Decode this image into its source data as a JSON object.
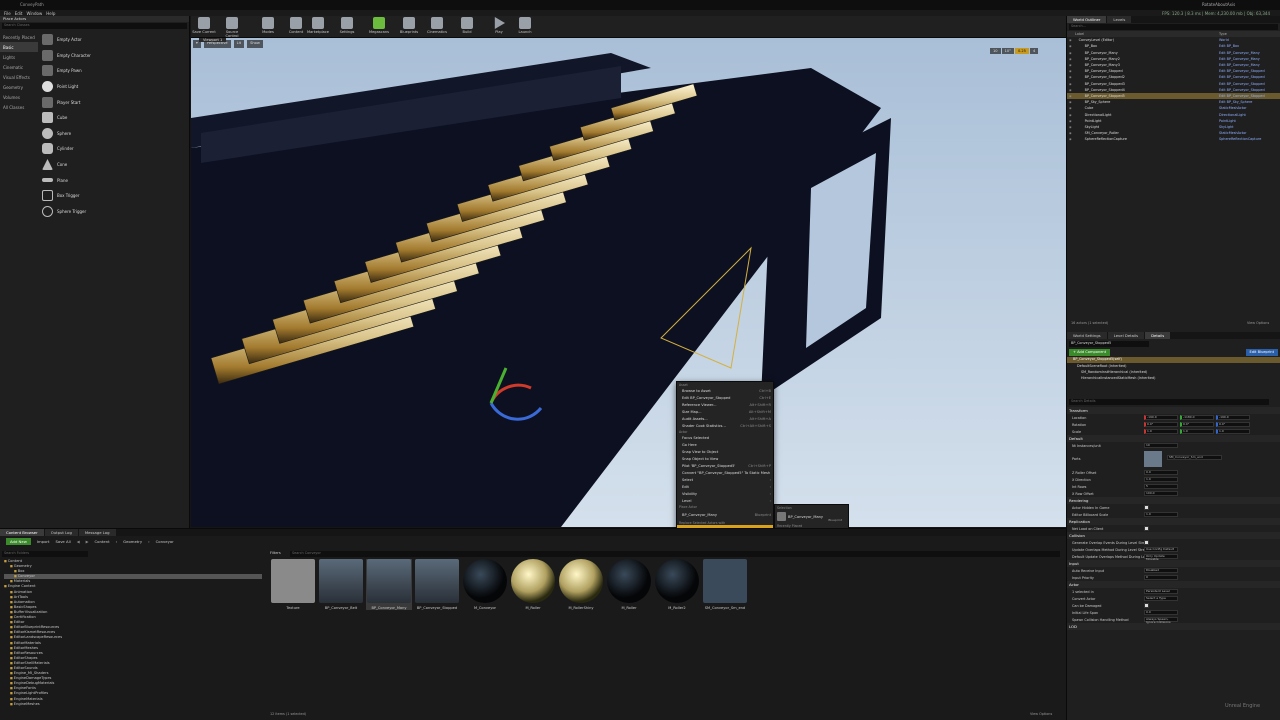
{
  "window": {
    "title": "ConveyPath",
    "right_title": "RotateAboutAxis",
    "stats": "FPS: 120.3  | 8.3 ms | Mem: 4,230.00 mb | Obj: 63,344"
  },
  "menu": [
    "File",
    "Edit",
    "Window",
    "Help"
  ],
  "modes": {
    "tab": "Place Actors",
    "search_placeholder": "Search Classes",
    "categories": [
      "Recently Placed",
      "Basic",
      "Lights",
      "Cinematic",
      "Visual Effects",
      "Geometry",
      "Volumes",
      "All Classes"
    ],
    "items": [
      "Empty Actor",
      "Empty Character",
      "Empty Pawn",
      "Point Light",
      "Player Start",
      "Cube",
      "Sphere",
      "Cylinder",
      "Cone",
      "Plane",
      "Box Trigger",
      "Sphere Trigger"
    ]
  },
  "toolbar": [
    {
      "label": "Save Current"
    },
    {
      "label": "Source Control"
    },
    {
      "label": "Modes"
    },
    {
      "label": "Content"
    },
    {
      "label": "Marketplace"
    },
    {
      "label": "Settings"
    },
    {
      "label": "Megascans"
    },
    {
      "label": "Blueprints"
    },
    {
      "label": "Cinematics"
    },
    {
      "label": "Build"
    },
    {
      "label": "Play"
    },
    {
      "label": "Launch"
    }
  ],
  "viewport": {
    "tab": "Viewport 1",
    "perspective": "Perspective",
    "lit": "Lit",
    "show": "Show",
    "grid": "10",
    "angle": "10°",
    "scale": "0.25",
    "cam": "4"
  },
  "context_menu": {
    "asset_header": "Asset",
    "actor_header": "Actor",
    "place_header": "Place Actor",
    "replace_header": "Replace Selected Actors with",
    "preview_header": "Preview",
    "event_header": "Level Blueprint Events",
    "asset_items": [
      {
        "label": "Browse to Asset",
        "sc": "Ctrl+B"
      },
      {
        "label": "Edit BP_Conveyor_Stopped",
        "sc": "Ctrl+E"
      },
      {
        "label": "Reference Viewer...",
        "sc": "Alt+Shift+R"
      },
      {
        "label": "Size Map...",
        "sc": "Alt+Shift+M"
      },
      {
        "label": "Audit Assets...",
        "sc": "Alt+Shift+A"
      },
      {
        "label": "Shader Cook Statistics...",
        "sc": "Ctrl+Alt+Shift+S"
      }
    ],
    "actor_items": [
      {
        "label": "Focus Selected",
        "sc": ""
      },
      {
        "label": "Go Here",
        "sc": ""
      },
      {
        "label": "Snap View to Object",
        "sc": ""
      },
      {
        "label": "Snap Object to View",
        "sc": ""
      },
      {
        "label": "Pilot 'BP_Conveyor_Stopped5'",
        "sc": "Ctrl+Shift+P"
      },
      {
        "label": "Convert \"BP_Conveyor_Stopped5\" To Static Mesh",
        "sc": ""
      }
    ],
    "mid_items": [
      "Select",
      "Edit",
      "Visibility",
      "Level"
    ],
    "place_item": "BP_Conveyor_Many",
    "place_type": "Blueprint",
    "replace_item": "BP_Conveyor_Many",
    "replace_type": "Blueprint",
    "lower_items": [
      "Merge Actors",
      "Attach To",
      "Transform",
      "Pivot"
    ],
    "preview_item": "Play From Here",
    "event_item": "Add Event"
  },
  "submenu": {
    "headers": [
      "Selection",
      "Recently Placed",
      "Lights",
      "Primitives",
      "Custom Actors"
    ],
    "selection": [
      {
        "label": "BP_Conveyor_Many",
        "type": "Blueprint"
      }
    ],
    "recent": [
      {
        "label": "BP_Conveyor_Many",
        "type": "Blueprint"
      },
      {
        "label": "BP_Conveyor_Belt",
        "type": "Blueprint"
      },
      {
        "label": "BP_Box",
        "type": "Blueprint"
      }
    ],
    "lights": [
      "Directional Light",
      "Spot Light",
      "Point Light",
      "Rect Light"
    ],
    "primitives": [
      "Camera Actor",
      "Player Start",
      "Blocking Volume",
      "Trigger"
    ],
    "custom": [
      "Runtime Virtual Texture Volume"
    ]
  },
  "outliner": {
    "tabs": [
      "World Outliner",
      "Levels"
    ],
    "col_label": "Label",
    "col_type": "Type",
    "search_placeholder": "Search...",
    "rows": [
      {
        "label": "ConveyLevel (Editor)",
        "type": "World"
      },
      {
        "label": "BP_Box",
        "type": "Edit BP_Box"
      },
      {
        "label": "BP_Conveyor_Many",
        "type": "Edit BP_Conveyor_Many"
      },
      {
        "label": "BP_Conveyor_Many2",
        "type": "Edit BP_Conveyor_Many"
      },
      {
        "label": "BP_Conveyor_Many3",
        "type": "Edit BP_Conveyor_Many"
      },
      {
        "label": "BP_Conveyor_Stopped",
        "type": "Edit BP_Conveyor_Stopped"
      },
      {
        "label": "BP_Conveyor_Stopped2",
        "type": "Edit BP_Conveyor_Stopped"
      },
      {
        "label": "BP_Conveyor_Stopped3",
        "type": "Edit BP_Conveyor_Stopped"
      },
      {
        "label": "BP_Conveyor_Stopped4",
        "type": "Edit BP_Conveyor_Stopped"
      },
      {
        "label": "BP_Conveyor_Stopped5",
        "type": "Edit BP_Conveyor_Stopped"
      },
      {
        "label": "BP_Sky_Sphere",
        "type": "Edit BP_Sky_Sphere"
      },
      {
        "label": "Cube",
        "type": "StaticMeshActor"
      },
      {
        "label": "DirectionalLight",
        "type": "DirectionalLight"
      },
      {
        "label": "PointLight",
        "type": "PointLight"
      },
      {
        "label": "SkyLight",
        "type": "SkyLight"
      },
      {
        "label": "SM_Conveyor_Roller",
        "type": "StaticMeshActor"
      },
      {
        "label": "SphereReflectionCapture",
        "type": "SphereReflectionCapture"
      }
    ],
    "footer": "16 actors (1 selected)",
    "view_options": "View Options"
  },
  "details": {
    "tabs": [
      "World Settings",
      "Level Details",
      "Details"
    ],
    "name": "BP_Conveyor_Stopped5",
    "add_component": "+ Add Component",
    "edit_bp": "Edit Blueprint",
    "self": "BP_Conveyor_Stopped5(self)",
    "comps": [
      "DefaultSceneRoot (Inherited)",
      "SM_RandomInstHierarchical (Inherited)",
      "HierarchicalInstancedStaticMesh (Inherited)"
    ],
    "search_placeholder": "Search Details",
    "transform": {
      "header": "Transform",
      "location": {
        "label": "Location",
        "x": "-190.0",
        "y": "-1180.0",
        "z": "-190.0"
      },
      "rotation": {
        "label": "Rotation",
        "x": "0.0°",
        "y": "0.0°",
        "z": "0.0°"
      },
      "scale": {
        "label": "Scale",
        "x": "1.0",
        "y": "1.0",
        "z": "1.0"
      }
    },
    "default": {
      "header": "Default",
      "rows": [
        {
          "label": "Nt Instances/unit",
          "val": "10"
        },
        {
          "label": "Parts",
          "val": "SM_Conveyor_Sm_end"
        },
        {
          "label": "Z Roller Offset",
          "val": "0.0"
        },
        {
          "label": "X Direction",
          "val": "1.0"
        },
        {
          "label": "Int Rows",
          "val": "5"
        },
        {
          "label": "X Row Offset",
          "val": "100.0"
        }
      ]
    },
    "rendering": {
      "header": "Rendering",
      "rows": [
        {
          "label": "Actor Hidden In Game",
          "val": ""
        },
        {
          "label": "Editor Billboard Scale",
          "val": "1.0"
        }
      ]
    },
    "replication": {
      "header": "Replication",
      "rows": [
        {
          "label": "Net Load on Client",
          "val": ""
        }
      ]
    },
    "collision": {
      "header": "Collision",
      "rows": [
        {
          "label": "Generate Overlap Events During Level Stre",
          "val": ""
        },
        {
          "label": "Update Overlaps Method During Level Stre",
          "val": "Use Config Default"
        },
        {
          "label": "Default Update Overlaps Method During Le",
          "val": "Only Update Movable"
        }
      ]
    },
    "input": {
      "header": "Input",
      "rows": [
        {
          "label": "Auto Receive Input",
          "val": "Disabled"
        },
        {
          "label": "Input Priority",
          "val": "0"
        }
      ]
    },
    "actor": {
      "header": "Actor",
      "rows": [
        {
          "label": "1 selected in",
          "val": "Persistent Level"
        },
        {
          "label": "Convert Actor",
          "val": "Select a Type"
        },
        {
          "label": "Can be Damaged",
          "val": ""
        },
        {
          "label": "Initial Life Span",
          "val": "0.0"
        },
        {
          "label": "Spawn Collision Handling Method",
          "val": "Always Spawn, Ignore Collisions"
        }
      ]
    },
    "lod": "LOD"
  },
  "content_browser": {
    "tabs": [
      "Content Browser",
      "Output Log",
      "Message Log"
    ],
    "add_new": "Add New",
    "import": "Import",
    "save_all": "Save All",
    "path": [
      "Content",
      "Geometry",
      "Conveyor"
    ],
    "search_folders": "Search Folders",
    "filters": "Filters",
    "search_assets": "Search Conveyor",
    "tree": [
      "Content",
      "Geometry",
      "Box",
      "Conveyor",
      "Materials",
      "Engine Content",
      "Animation",
      "ArtTools",
      "Automation",
      "BasicShapes",
      "BufferVisualization",
      "Certification",
      "Editor",
      "EditorBlueprintResources",
      "EditorKismetResources",
      "EditorLandscapeResources",
      "EditorMaterials",
      "EditorMeshes",
      "EditorResources",
      "EditorShapes",
      "EditorShellMaterials",
      "EditorSounds",
      "Engine_MI_Shaders",
      "EngineDamageTypes",
      "EngineDebugMaterials",
      "EngineFonts",
      "EngineLightProfiles",
      "EngineMaterials",
      "EngineMeshes"
    ],
    "assets": [
      {
        "label": "Texture",
        "kind": "folder"
      },
      {
        "label": "BP_Conveyor_Belt",
        "kind": "bp"
      },
      {
        "label": "BP_Conveyor_Many",
        "kind": "bp"
      },
      {
        "label": "BP_Conveyor_Stopped",
        "kind": "bp"
      },
      {
        "label": "M_Conveyor",
        "kind": "dark"
      },
      {
        "label": "M_Roller",
        "kind": "gold"
      },
      {
        "label": "M_RollerShiny",
        "kind": "gold"
      },
      {
        "label": "M_Roller",
        "kind": "dark"
      },
      {
        "label": "M_Roller2",
        "kind": "dark"
      },
      {
        "label": "SM_Conveyor_Sm_end",
        "kind": "mesh"
      }
    ],
    "footer": "12 items (1 selected)",
    "view_options": "View Options"
  },
  "watermark": "Unreal Engine",
  "colors": {
    "accent": "#d8a21a",
    "select_green": "#3b8a2b",
    "link": "#8fb0ff",
    "sky": "#b8cbe0"
  }
}
